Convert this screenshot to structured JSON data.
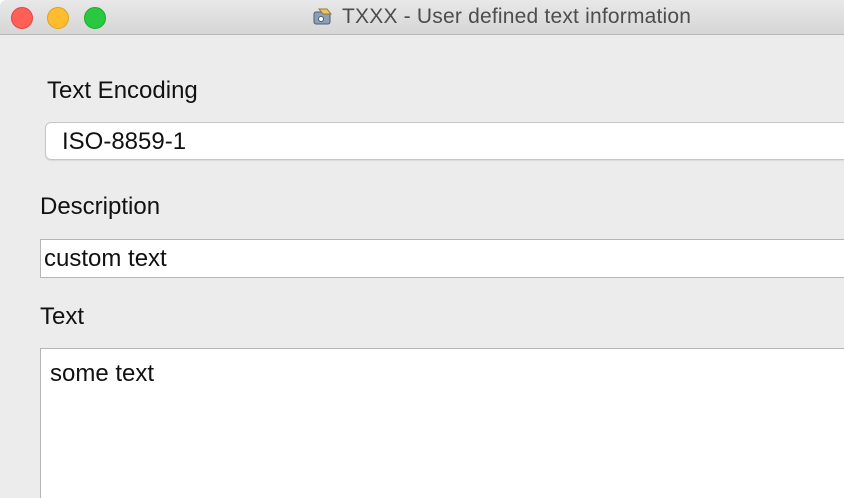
{
  "window": {
    "title": "TXXX - User defined text information",
    "app_icon": "id3-tag-icon"
  },
  "encoding": {
    "label": "Text Encoding",
    "value": "ISO-8859-1"
  },
  "description": {
    "label": "Description",
    "value": "custom text"
  },
  "text": {
    "label": "Text",
    "value": "some text"
  },
  "colors": {
    "close": "#fe5f57",
    "minimize": "#febc2e",
    "zoom": "#28c840",
    "window_bg": "#ececec"
  }
}
